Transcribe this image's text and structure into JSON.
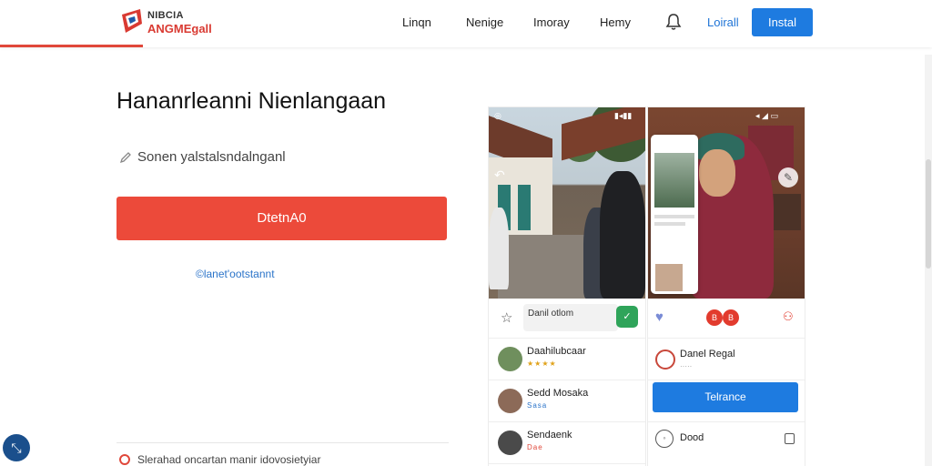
{
  "header": {
    "logo_line1": "NIBCIA",
    "logo_line2": "ANGMEgall",
    "nav": [
      "Linqn",
      "Nenige",
      "Imoray",
      "Hemy"
    ],
    "login_label": "Loirall",
    "install_label": "Instal"
  },
  "hero": {
    "title": "Hananrleanni Nienlangaan",
    "subtitle": "Sonen yalstalsndalnganl",
    "cta_label": "DtetnA0",
    "secondary_link": "©lanet'ootstannt",
    "footnote": "Slerahad oncartan manir idovosietyiar"
  },
  "fab_icon": "arrow-collapse-icon",
  "left_screen": {
    "chip_text": "Danil otlom",
    "contacts": [
      {
        "name": "Daahilubcaar",
        "sub": "★★★★",
        "avatar_color": "#6f8f5d"
      },
      {
        "name": "Sedd Mosaka",
        "sub": "Sasa",
        "avatar_color": "#8c6a58"
      },
      {
        "name": "Sendaenk",
        "sub": "Dae",
        "avatar_color": "#4a4a4a"
      }
    ]
  },
  "right_screen": {
    "badges": [
      "B",
      "B"
    ],
    "profile_name": "Danel Regal",
    "profile_sub": "·····",
    "follow_label": "Telrance",
    "bottom_label": "Dood"
  },
  "colors": {
    "brand_red": "#ec4a3a",
    "primary_blue": "#1e7be0",
    "link_blue": "#2b74c9"
  }
}
